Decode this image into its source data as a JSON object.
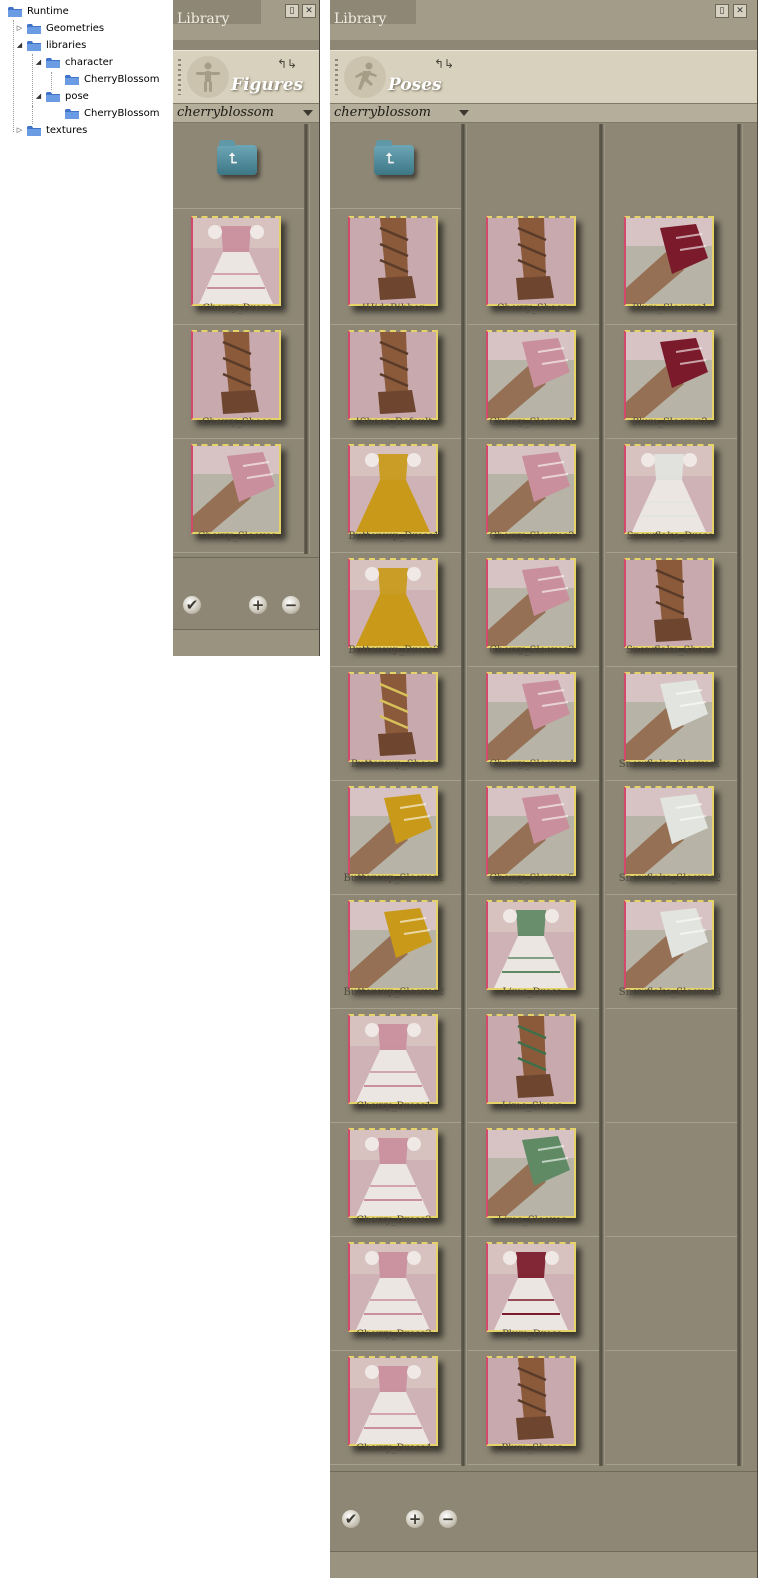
{
  "tree": {
    "nodes": [
      {
        "label": "Runtime",
        "expander": ""
      },
      {
        "label": "Geometries",
        "expander": "▷"
      },
      {
        "label": "libraries",
        "expander": "◢"
      },
      {
        "label": "character",
        "expander": "◢"
      },
      {
        "label": "CherryBlossom",
        "expander": ""
      },
      {
        "label": "pose",
        "expander": "◢"
      },
      {
        "label": "CherryBlossom",
        "expander": ""
      },
      {
        "label": "textures",
        "expander": "▷"
      }
    ]
  },
  "figures_panel": {
    "title": "Library",
    "category": "Figures",
    "folder": "cherryblossom",
    "items": [
      "Cherry_Dress",
      "Cherry_Shoes",
      "Cherry_Sleeves"
    ]
  },
  "poses_panel": {
    "title": "Library",
    "category": "Poses",
    "folder": "cherryblossom",
    "columns": [
      [
        "!HideRibbon",
        "!Shoes_Default",
        "Buttercup_Dress1",
        "Buttercup_Dress2",
        "Buttercup_Shoes",
        "Buttercup_Sleeves1",
        "Buttercup_Sleeves2",
        "Cherry_Dress1",
        "Cherry_Dress2",
        "Cherry_Dress3",
        "Cherry_Dress4"
      ],
      [
        "Cherry_Shoes",
        "Cherry_Sleeves1",
        "Cherry_Sleeves2",
        "Cherry_Sleeves3",
        "Cherry_Sleeves4",
        "Cherry_Sleeves5",
        "Lime_Dress",
        "Lime_Shoes",
        "Lime_Sleeves",
        "Plum_Dress",
        "Plum_Shoes"
      ],
      [
        "Plum_Sleeves1",
        "Plum_Sleeves2",
        "Snowflake_Dress",
        "Snowflake_Shoes",
        "Snowflake_Sleeves1",
        "Snowflake_Sleeves2",
        "Snowflake_Sleeves3"
      ]
    ]
  },
  "colors": {
    "panel_bg": "#8e8775",
    "header_bg": "#d8d1bd",
    "folder_accent": "#4f8a99",
    "cherry": "#c98f9c",
    "buttercup": "#c99a1a",
    "lime": "#5f8a64",
    "plum": "#7a1a2a",
    "snowflake": "#e2e4df",
    "skin": "#8a5a3a"
  },
  "icons": {
    "check": "✔",
    "add": "+",
    "remove": "−",
    "up_folder": "⮤",
    "swap": "⮂"
  }
}
